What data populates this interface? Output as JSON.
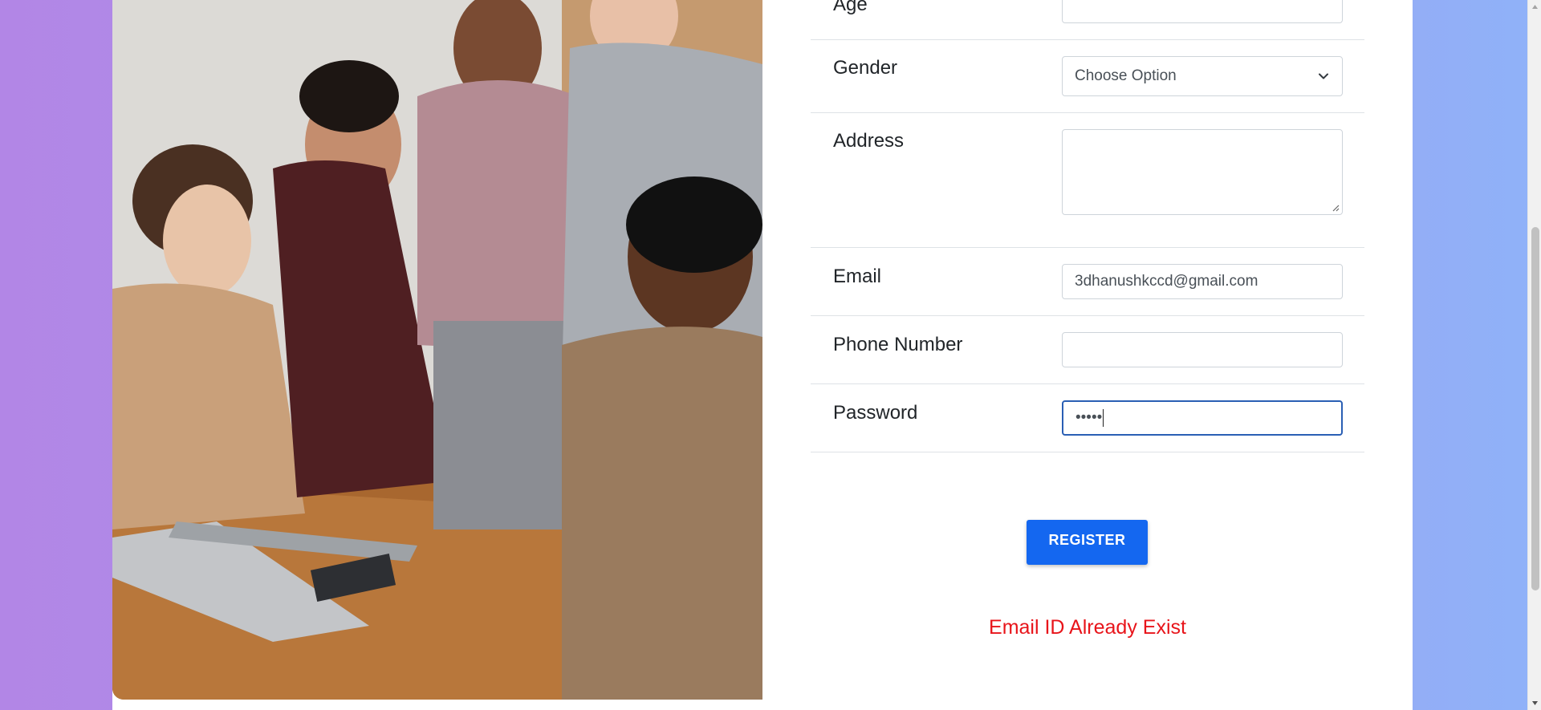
{
  "form": {
    "age": {
      "label": "Age",
      "value": ""
    },
    "gender": {
      "label": "Gender",
      "selected": "Choose Option"
    },
    "address": {
      "label": "Address",
      "value": ""
    },
    "email": {
      "label": "Email",
      "value": "3dhanushkccd@gmail.com"
    },
    "phone": {
      "label": "Phone Number",
      "value": ""
    },
    "password": {
      "label": "Password",
      "masked_value": "•••••"
    }
  },
  "register_label": "REGISTER",
  "error_message": "Email ID Already Exist",
  "colors": {
    "accent": "#1467f0",
    "error": "#e8141a",
    "bg_left": "#b286e6",
    "bg_right": "#8fb2f8"
  },
  "icons": {
    "select": "chevron-down-icon",
    "textarea": "resize-grip-icon",
    "scroll_up": "scroll-up-arrow-icon",
    "scroll_down": "scroll-down-arrow-icon"
  }
}
